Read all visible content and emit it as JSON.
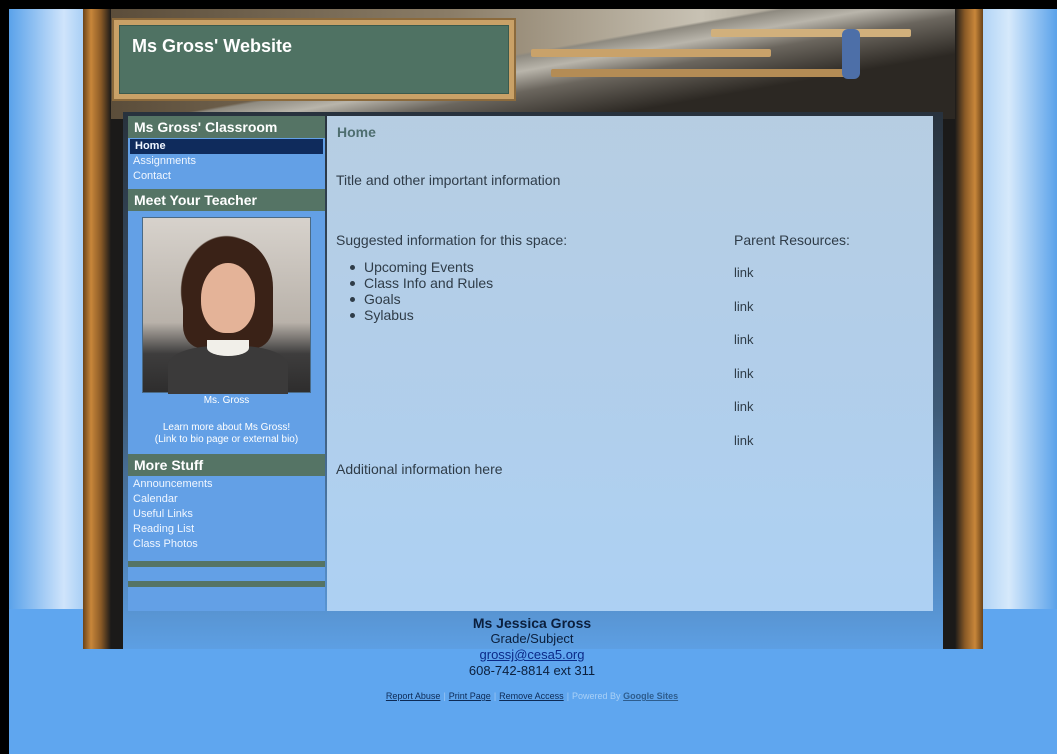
{
  "site": {
    "title": "Ms Gross' Website"
  },
  "sidebar": {
    "classroom_heading": "Ms Gross' Classroom",
    "classroom_items": [
      {
        "label": "Home",
        "active": true
      },
      {
        "label": "Assignments"
      },
      {
        "label": "Contact"
      }
    ],
    "teacher_heading": "Meet Your Teacher",
    "photo_caption": "Ms. Gross",
    "learn_more_line1": "Learn more about Ms Gross!",
    "learn_more_line2": "(Link to bio page or external bio)",
    "more_heading": "More Stuff",
    "more_items": [
      {
        "label": "Announcements"
      },
      {
        "label": "Calendar"
      },
      {
        "label": "Useful Links"
      },
      {
        "label": "Reading List"
      },
      {
        "label": "Class Photos"
      }
    ]
  },
  "content": {
    "page_title": "Home",
    "intro": "Title and other important information",
    "suggested": "Suggested information for this space:",
    "bullets": [
      "Upcoming Events",
      "Class Info and Rules",
      "Goals",
      "Sylabus"
    ],
    "parent_heading": "Parent Resources:",
    "links": [
      "link",
      "link",
      "link",
      "link",
      "link",
      "link"
    ],
    "additional": "Additional information here"
  },
  "footer": {
    "name": "Ms Jessica Gross",
    "subject": "Grade/Subject",
    "email": "grossj@cesa5.org",
    "phone": "608-742-8814 ext 311",
    "links": [
      "Report Abuse",
      "Print Page",
      "Remove Access"
    ],
    "powered_by": "Powered By",
    "google_sites": "Google Sites"
  },
  "colors": {
    "heading_bg": "#557465",
    "sidebar_bg": "#63a0e6",
    "active_item_bg": "#0f2b5c",
    "page_bg": "#5da4ee"
  }
}
